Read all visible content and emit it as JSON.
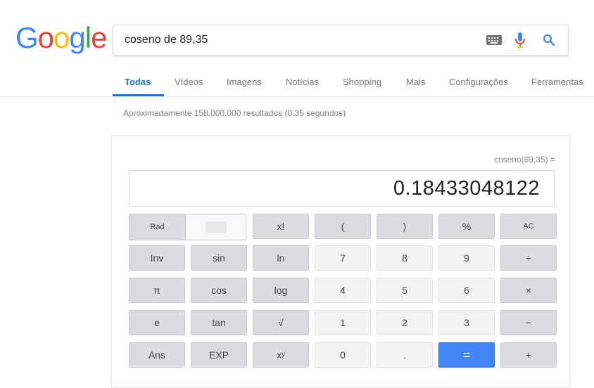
{
  "logo": [
    "G",
    "o",
    "o",
    "g",
    "l",
    "e"
  ],
  "colors": {
    "blue": "#4285f4",
    "red": "#ea4335",
    "yellow": "#fbbc05",
    "green": "#34a853",
    "accent": "#1a73e8"
  },
  "search": {
    "query": "coseno de 89,35"
  },
  "tabs": [
    "Todas",
    "Vídeos",
    "Imagens",
    "Notícias",
    "Shopping",
    "Mais",
    "Configurações",
    "Ferramentas"
  ],
  "results_stats": "Aproximadamente 158.000.000 resultados (0,35 segundos)",
  "calculator": {
    "expression": "coseno(89,35) =",
    "result": "0.18433048122",
    "angle_mode": "Rad",
    "row1": [
      "x!",
      "(",
      ")",
      "%",
      "AC"
    ],
    "row2": [
      "Inv",
      "sin",
      "ln",
      "7",
      "8",
      "9",
      "÷"
    ],
    "row3": [
      "π",
      "cos",
      "log",
      "4",
      "5",
      "6",
      "×"
    ],
    "row4": [
      "e",
      "tan",
      "√",
      "1",
      "2",
      "3",
      "−"
    ],
    "row5": [
      "Ans",
      "EXP",
      "xʸ",
      "0",
      ".",
      "=",
      "+"
    ]
  }
}
